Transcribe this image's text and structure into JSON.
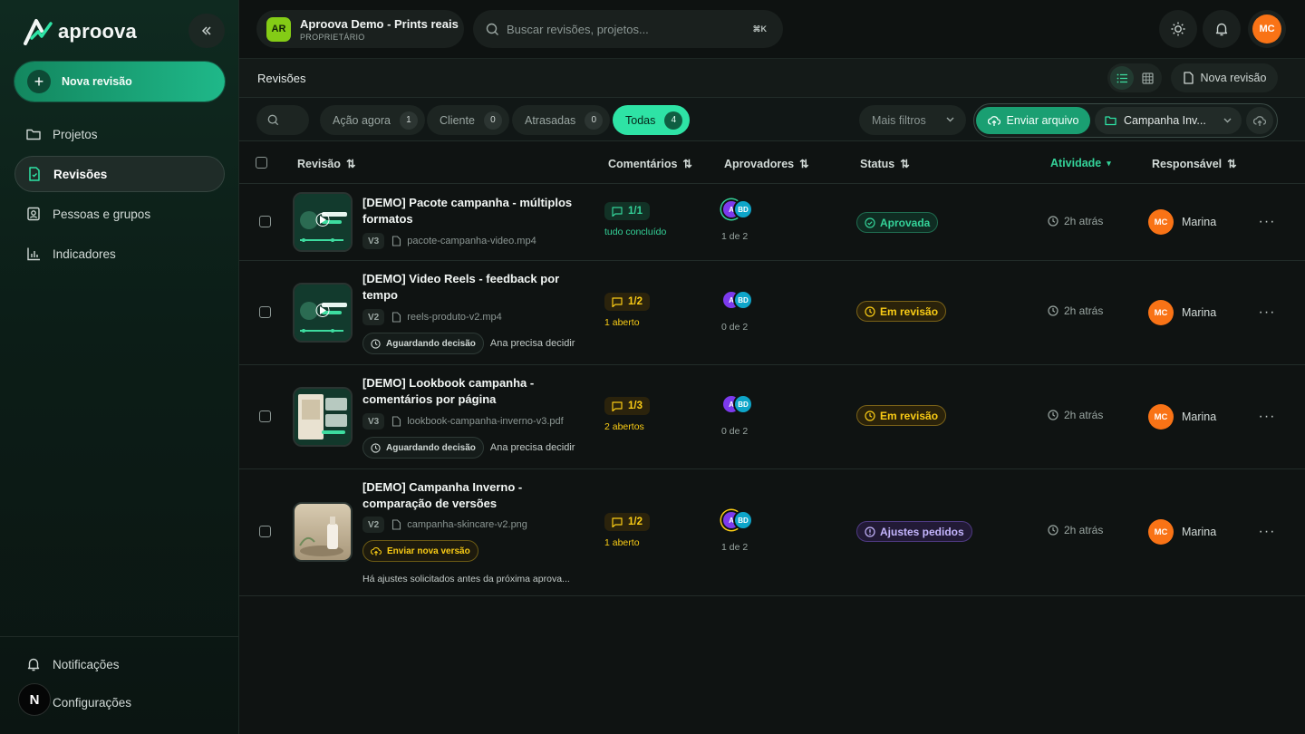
{
  "brand": {
    "name": "aproova"
  },
  "sidebar": {
    "new_review_label": "Nova revisão",
    "items": [
      {
        "label": "Projetos",
        "icon": "folder-icon"
      },
      {
        "label": "Revisões",
        "icon": "document-icon",
        "active": true
      },
      {
        "label": "Pessoas e grupos",
        "icon": "contacts-icon"
      },
      {
        "label": "Indicadores",
        "icon": "chart-icon"
      }
    ],
    "notifications_label": "Notificações",
    "settings_label": "Configurações",
    "bottom_badge": "N"
  },
  "workspace": {
    "initials": "AR",
    "name": "Aproova Demo - Prints reais",
    "role": "PROPRIETÁRIO"
  },
  "search": {
    "placeholder": "Buscar revisões, projetos...",
    "shortcut": "⌘K"
  },
  "user": {
    "initials": "MC"
  },
  "header": {
    "title": "Revisões",
    "new_review_label": "Nova revisão"
  },
  "filters": {
    "chips": [
      {
        "label": "Ação agora",
        "count": "1"
      },
      {
        "label": "Cliente",
        "count": "0"
      },
      {
        "label": "Atrasadas",
        "count": "0"
      },
      {
        "label": "Todas",
        "count": "4",
        "active": true
      }
    ],
    "more_filters": "Mais filtros",
    "upload_label": "Enviar arquivo",
    "project_select": "Campanha Inv..."
  },
  "table": {
    "columns": {
      "revision": "Revisão",
      "comments": "Comentários",
      "approvers": "Aprovadores",
      "status": "Status",
      "activity": "Atividade",
      "responsible": "Responsável"
    },
    "rows": [
      {
        "title": "[DEMO] Pacote campanha - múltiplos formatos",
        "version": "V3",
        "file": "pacote-campanha-video.mp4",
        "comments": "1/1",
        "comments_sub": "tudo concluído",
        "comments_color": "green",
        "approvers": [
          "A",
          "BD"
        ],
        "approvers_sub": "1 de 2",
        "status": "Aprovada",
        "status_kind": "green",
        "activity": "2h atrás",
        "resp_initials": "MC",
        "resp_name": "Marina"
      },
      {
        "title": "[DEMO] Video Reels - feedback por tempo",
        "version": "V2",
        "file": "reels-produto-v2.mp4",
        "tag": "Aguardando decisão",
        "tag_note": "Ana precisa decidir",
        "comments": "1/2",
        "comments_sub": "1 aberto",
        "comments_color": "yellow",
        "approvers": [
          "A",
          "BD"
        ],
        "approvers_sub": "0 de 2",
        "status": "Em revisão",
        "status_kind": "yellow",
        "activity": "2h atrás",
        "resp_initials": "MC",
        "resp_name": "Marina"
      },
      {
        "title": "[DEMO] Lookbook campanha - comentários por página",
        "version": "V3",
        "file": "lookbook-campanha-inverno-v3.pdf",
        "tag": "Aguardando decisão",
        "tag_note": "Ana precisa decidir",
        "comments": "1/3",
        "comments_sub": "2 abertos",
        "comments_color": "yellow",
        "approvers": [
          "A",
          "BD"
        ],
        "approvers_sub": "0 de 2",
        "status": "Em revisão",
        "status_kind": "yellow",
        "activity": "2h atrás",
        "resp_initials": "MC",
        "resp_name": "Marina"
      },
      {
        "title": "[DEMO] Campanha Inverno - comparação de versões",
        "version": "V2",
        "file": "campanha-skincare-v2.png",
        "tag": "Enviar nova versão",
        "hint": "Há ajustes solicitados antes da próxima aprova...",
        "comments": "1/2",
        "comments_sub": "1 aberto",
        "comments_color": "yellow",
        "approvers": [
          "A",
          "BD"
        ],
        "approvers_sub": "1 de 2",
        "status": "Ajustes pedidos",
        "status_kind": "purple",
        "activity": "2h atrás",
        "resp_initials": "MC",
        "resp_name": "Marina"
      }
    ]
  },
  "colors": {
    "accent": "#2ee3a5",
    "brand_green": "#1a9f72",
    "warning": "#facc15",
    "purple": "#c4b5fd",
    "avatar_orange": "#f97316"
  }
}
